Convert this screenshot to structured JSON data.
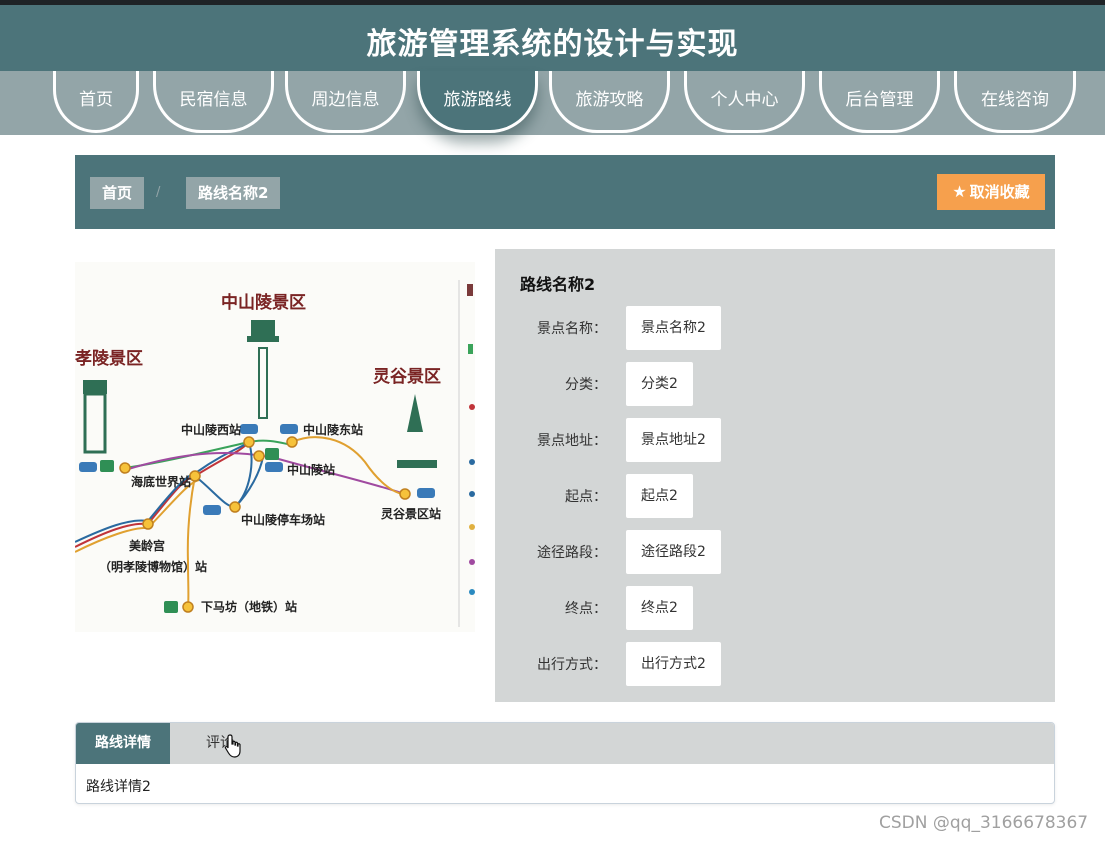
{
  "site": {
    "title": "旅游管理系统的设计与实现"
  },
  "nav": {
    "items": [
      "首页",
      "民宿信息",
      "周边信息",
      "旅游路线",
      "旅游攻略",
      "个人中心",
      "后台管理",
      "在线咨询"
    ],
    "active": "旅游路线"
  },
  "breadcrumb": {
    "home": "首页",
    "separator": "/",
    "current": "路线名称2"
  },
  "favorite": {
    "label": "取消收藏",
    "icon": "star-icon",
    "color": "#f6a04d"
  },
  "map": {
    "labels": [
      "中山陵景区",
      "孝陵景区",
      "灵谷景区",
      "中山陵西站",
      "中山陵东站",
      "中山陵站",
      "海底世界站",
      "中山陵停车场站",
      "灵谷景区站",
      "美龄宫",
      "（明孝陵博物馆）站",
      "下马坊（地铁）站"
    ]
  },
  "details": {
    "title": "路线名称2",
    "rows": [
      {
        "label": "景点名称：",
        "value": "景点名称2"
      },
      {
        "label": "分类：",
        "value": "分类2"
      },
      {
        "label": "景点地址：",
        "value": "景点地址2"
      },
      {
        "label": "起点：",
        "value": "起点2"
      },
      {
        "label": "途径路段：",
        "value": "途径路段2"
      },
      {
        "label": "终点：",
        "value": "终点2"
      },
      {
        "label": "出行方式：",
        "value": "出行方式2"
      }
    ]
  },
  "tabs": {
    "items": [
      "路线详情",
      "评论"
    ],
    "active": "路线详情",
    "content": "路线详情2"
  },
  "watermark": "CSDN @qq_3166678367",
  "colors": {
    "primary": "#4c747a",
    "nav": "#93a5a8",
    "panel": "#d3d6d6"
  }
}
